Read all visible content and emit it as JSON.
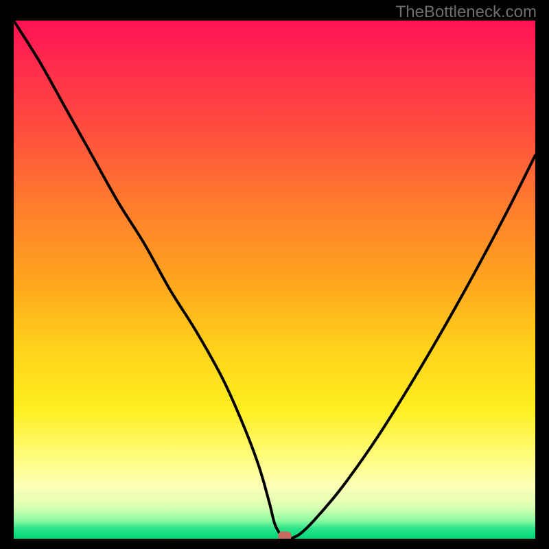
{
  "watermark": "TheBottleneck.com",
  "colors": {
    "page_bg": "#000000",
    "gradient_top": "#ff1254",
    "gradient_mid_high": "#ff7a2e",
    "gradient_mid": "#ffd41a",
    "gradient_pale": "#fdffb8",
    "gradient_green": "#00d878",
    "curve_stroke": "#000000",
    "marker_fill": "#c96a60",
    "watermark_color": "#6e6e6e"
  },
  "chart_data": {
    "type": "line",
    "title": "",
    "xlabel": "",
    "ylabel": "",
    "xlim": [
      0,
      100
    ],
    "ylim": [
      0,
      100
    ],
    "grid": false,
    "legend": false,
    "note": "V-shaped curve over a red→orange→yellow→green vertical gradient. y≈100 means worst (top, red), y≈0 means best (bottom, green). Minimum sits around x≈52, y≈0, marked by a small rounded badge.",
    "series": [
      {
        "name": "curve",
        "x": [
          0,
          5,
          10,
          15,
          20,
          25,
          30,
          35,
          40,
          44,
          47,
          49,
          50,
          51,
          52,
          53,
          55,
          58,
          63,
          70,
          78,
          86,
          94,
          100
        ],
        "y": [
          100,
          92,
          83,
          74,
          65,
          57,
          48,
          40,
          31,
          22,
          14,
          7,
          3,
          1,
          0,
          0,
          1,
          4,
          10,
          20,
          33,
          47,
          62,
          74
        ]
      }
    ],
    "marker": {
      "x": 52,
      "y": 0
    }
  }
}
